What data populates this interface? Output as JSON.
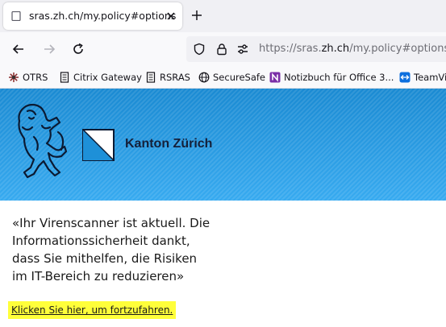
{
  "tab": {
    "title": "sras.zh.ch/my.policy#options"
  },
  "navbar": {
    "url_prefix": "https://sras.",
    "url_host": "zh.ch",
    "url_path": "/my.policy#options"
  },
  "bookmarks": [
    {
      "label": "OTRS",
      "icon": "otrs-icon"
    },
    {
      "label": "Citrix Gateway",
      "icon": "page-icon"
    },
    {
      "label": "RSRAS",
      "icon": "page-icon"
    },
    {
      "label": "SecureSafe",
      "icon": "globe-icon"
    },
    {
      "label": "Notizbuch für Office 3...",
      "icon": "onenote-icon"
    },
    {
      "label": "TeamVi",
      "icon": "teamviewer-icon"
    }
  ],
  "page": {
    "canton_name": "Kanton Zürich",
    "message_lines": [
      "«Ihr Virenscanner ist aktuell. Die",
      "Informationssicherheit dankt,",
      "dass Sie mithelfen, die Risiken",
      "im IT-Bereich zu reduzieren»"
    ],
    "continue_link": "Klicken Sie hier, um fortzufahren."
  },
  "colors": {
    "banner": "#2f9fe0",
    "link_highlight": "#ffff3a",
    "onenote": "#7b2fa7",
    "teamviewer": "#0e6fde"
  }
}
